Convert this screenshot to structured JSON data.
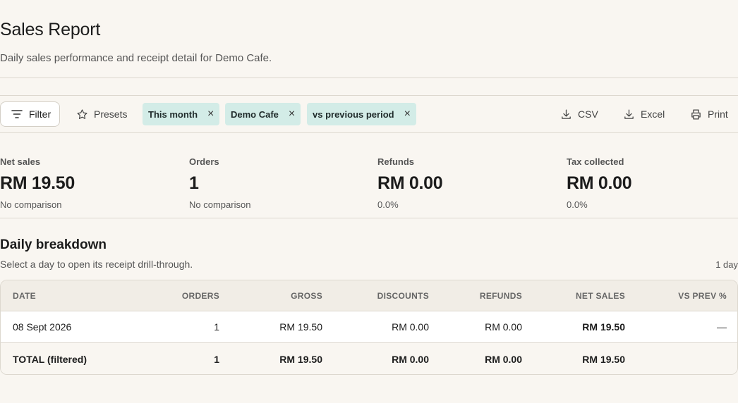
{
  "header": {
    "title": "Sales Report",
    "subtitle": "Daily sales performance and receipt detail for Demo Cafe."
  },
  "toolbar": {
    "filter_label": "Filter",
    "presets_label": "Presets",
    "chips": [
      {
        "label": "This month"
      },
      {
        "label": "Demo Cafe"
      },
      {
        "label": "vs previous period"
      }
    ],
    "chip_remove_glyph": "×",
    "csv_label": "CSV",
    "excel_label": "Excel",
    "print_label": "Print"
  },
  "kpis": [
    {
      "label": "Net sales",
      "value": "RM 19.50",
      "note": "No comparison"
    },
    {
      "label": "Orders",
      "value": "1",
      "note": "No comparison"
    },
    {
      "label": "Refunds",
      "value": "RM 0.00",
      "note": "0.0%"
    },
    {
      "label": "Tax collected",
      "value": "RM 0.00",
      "note": "0.0%"
    }
  ],
  "breakdown": {
    "title": "Daily breakdown",
    "subtitle": "Select a day to open its receipt drill-through.",
    "count": "1 day",
    "columns": [
      "DATE",
      "ORDERS",
      "GROSS",
      "DISCOUNTS",
      "REFUNDS",
      "NET SALES",
      "VS PREV %"
    ],
    "rows": [
      [
        "08 Sept 2026",
        "1",
        "RM 19.50",
        "RM 0.00",
        "RM 0.00",
        "RM 19.50",
        "—"
      ]
    ],
    "total": [
      "TOTAL (filtered)",
      "1",
      "RM 19.50",
      "RM 0.00",
      "RM 0.00",
      "RM 19.50",
      ""
    ]
  },
  "colors": {
    "background": "#f9f6f1",
    "chip": "#d3ece7",
    "border": "#ddd8cf"
  }
}
